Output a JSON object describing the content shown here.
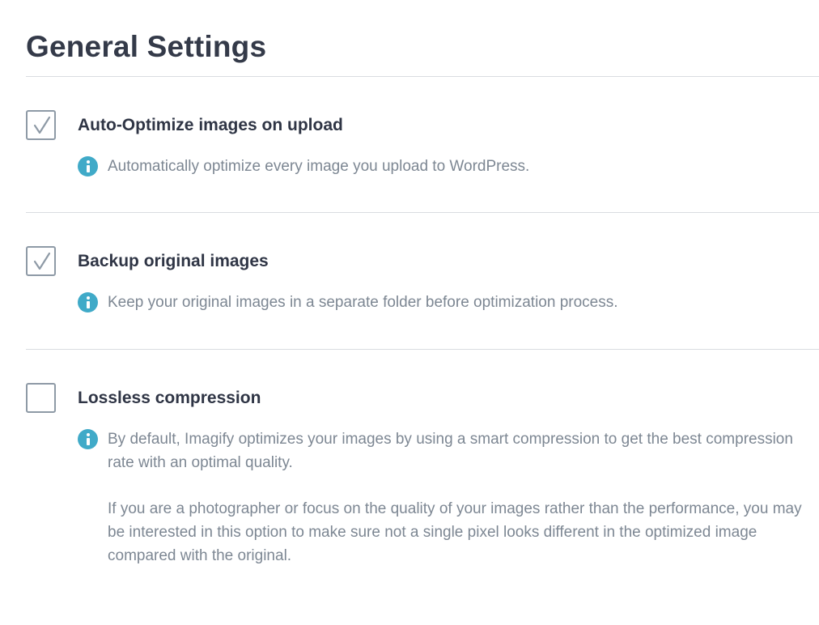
{
  "page": {
    "title": "General Settings"
  },
  "colors": {
    "text_dark": "#2f3545",
    "text_muted": "#7d8793",
    "info_icon": "#40aac8",
    "checkbox_border": "#8e9aa6",
    "divider": "#d9dce1"
  },
  "settings": [
    {
      "label": "Auto-Optimize images on upload",
      "checked": true,
      "description": [
        "Automatically optimize every image you upload to WordPress."
      ]
    },
    {
      "label": "Backup original images",
      "checked": true,
      "description": [
        "Keep your original images in a separate folder before optimization process."
      ]
    },
    {
      "label": "Lossless compression",
      "checked": false,
      "description": [
        "By default, Imagify optimizes your images by using a smart compression to get the best compression rate with an optimal quality.",
        "If you are a photographer or focus on the quality of your images rather than the performance, you may be interested in this option to make sure not a single pixel looks different in the optimized image compared with the original."
      ]
    }
  ]
}
